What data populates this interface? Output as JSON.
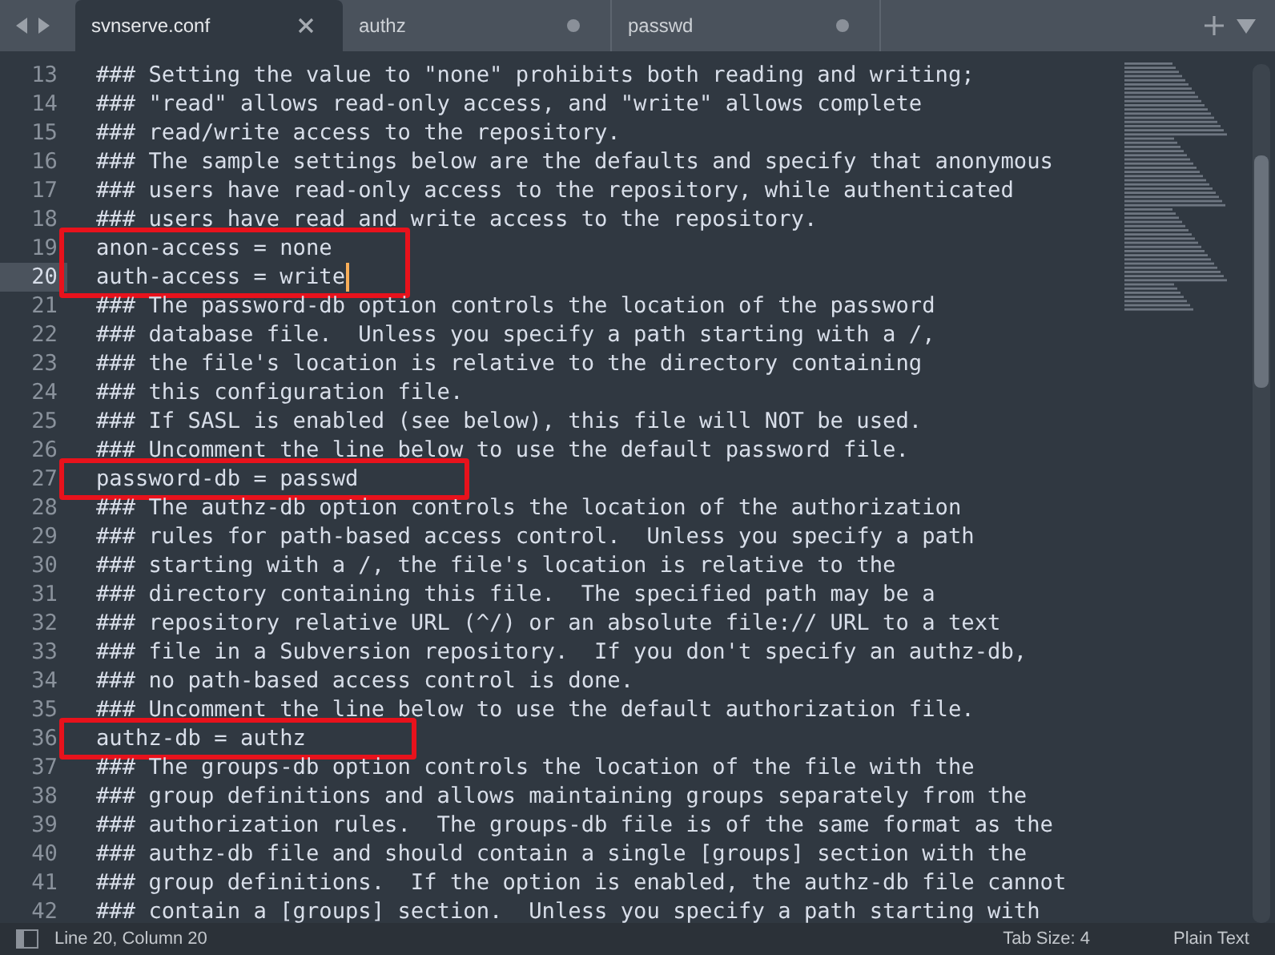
{
  "tabs": [
    {
      "label": "svnserve.conf",
      "selected": true,
      "modified": false
    },
    {
      "label": "authz",
      "selected": false,
      "modified": true
    },
    {
      "label": "passwd",
      "selected": false,
      "modified": true
    }
  ],
  "lines": [
    {
      "number": "13",
      "text": "### Setting the value to \"none\" prohibits both reading and writing;",
      "boxed": false,
      "current": false
    },
    {
      "number": "14",
      "text": "### \"read\" allows read-only access, and \"write\" allows complete",
      "boxed": false,
      "current": false
    },
    {
      "number": "15",
      "text": "### read/write access to the repository.",
      "boxed": false,
      "current": false
    },
    {
      "number": "16",
      "text": "### The sample settings below are the defaults and specify that anonymous",
      "boxed": false,
      "current": false
    },
    {
      "number": "17",
      "text": "### users have read-only access to the repository, while authenticated",
      "boxed": false,
      "current": false
    },
    {
      "number": "18",
      "text": "### users have read and write access to the repository.",
      "boxed": false,
      "current": false
    },
    {
      "number": "19",
      "text": "anon-access = none",
      "boxed": true,
      "current": false
    },
    {
      "number": "20",
      "text": "auth-access = write",
      "boxed": true,
      "current": true
    },
    {
      "number": "21",
      "text": "### The password-db option controls the location of the password",
      "boxed": false,
      "current": false
    },
    {
      "number": "22",
      "text": "### database file.  Unless you specify a path starting with a /,",
      "boxed": false,
      "current": false
    },
    {
      "number": "23",
      "text": "### the file's location is relative to the directory containing",
      "boxed": false,
      "current": false
    },
    {
      "number": "24",
      "text": "### this configuration file.",
      "boxed": false,
      "current": false
    },
    {
      "number": "25",
      "text": "### If SASL is enabled (see below), this file will NOT be used.",
      "boxed": false,
      "current": false
    },
    {
      "number": "26",
      "text": "### Uncomment the line below to use the default password file.",
      "boxed": false,
      "current": false
    },
    {
      "number": "27",
      "text": "password-db = passwd",
      "boxed": true,
      "current": false
    },
    {
      "number": "28",
      "text": "### The authz-db option controls the location of the authorization",
      "boxed": false,
      "current": false
    },
    {
      "number": "29",
      "text": "### rules for path-based access control.  Unless you specify a path",
      "boxed": false,
      "current": false
    },
    {
      "number": "30",
      "text": "### starting with a /, the file's location is relative to the",
      "boxed": false,
      "current": false
    },
    {
      "number": "31",
      "text": "### directory containing this file.  The specified path may be a",
      "boxed": false,
      "current": false
    },
    {
      "number": "32",
      "text": "### repository relative URL (^/) or an absolute file:// URL to a text",
      "boxed": false,
      "current": false
    },
    {
      "number": "33",
      "text": "### file in a Subversion repository.  If you don't specify an authz-db,",
      "boxed": false,
      "current": false
    },
    {
      "number": "34",
      "text": "### no path-based access control is done.",
      "boxed": false,
      "current": false
    },
    {
      "number": "35",
      "text": "### Uncomment the line below to use the default authorization file.",
      "boxed": false,
      "current": false
    },
    {
      "number": "36",
      "text": "authz-db = authz",
      "boxed": true,
      "current": false
    },
    {
      "number": "37",
      "text": "### The groups-db option controls the location of the file with the",
      "boxed": false,
      "current": false
    },
    {
      "number": "38",
      "text": "### group definitions and allows maintaining groups separately from the",
      "boxed": false,
      "current": false
    },
    {
      "number": "39",
      "text": "### authorization rules.  The groups-db file is of the same format as the",
      "boxed": false,
      "current": false
    },
    {
      "number": "40",
      "text": "### authz-db file and should contain a single [groups] section with the",
      "boxed": false,
      "current": false
    },
    {
      "number": "41",
      "text": "### group definitions.  If the option is enabled, the authz-db file cannot",
      "boxed": false,
      "current": false
    },
    {
      "number": "42",
      "text": "### contain a [groups] section.  Unless you specify a path starting with",
      "boxed": false,
      "current": false
    }
  ],
  "status_bar": {
    "position": "Line 20, Column 20",
    "tab_size": "Tab Size: 4",
    "syntax": "Plain Text"
  }
}
